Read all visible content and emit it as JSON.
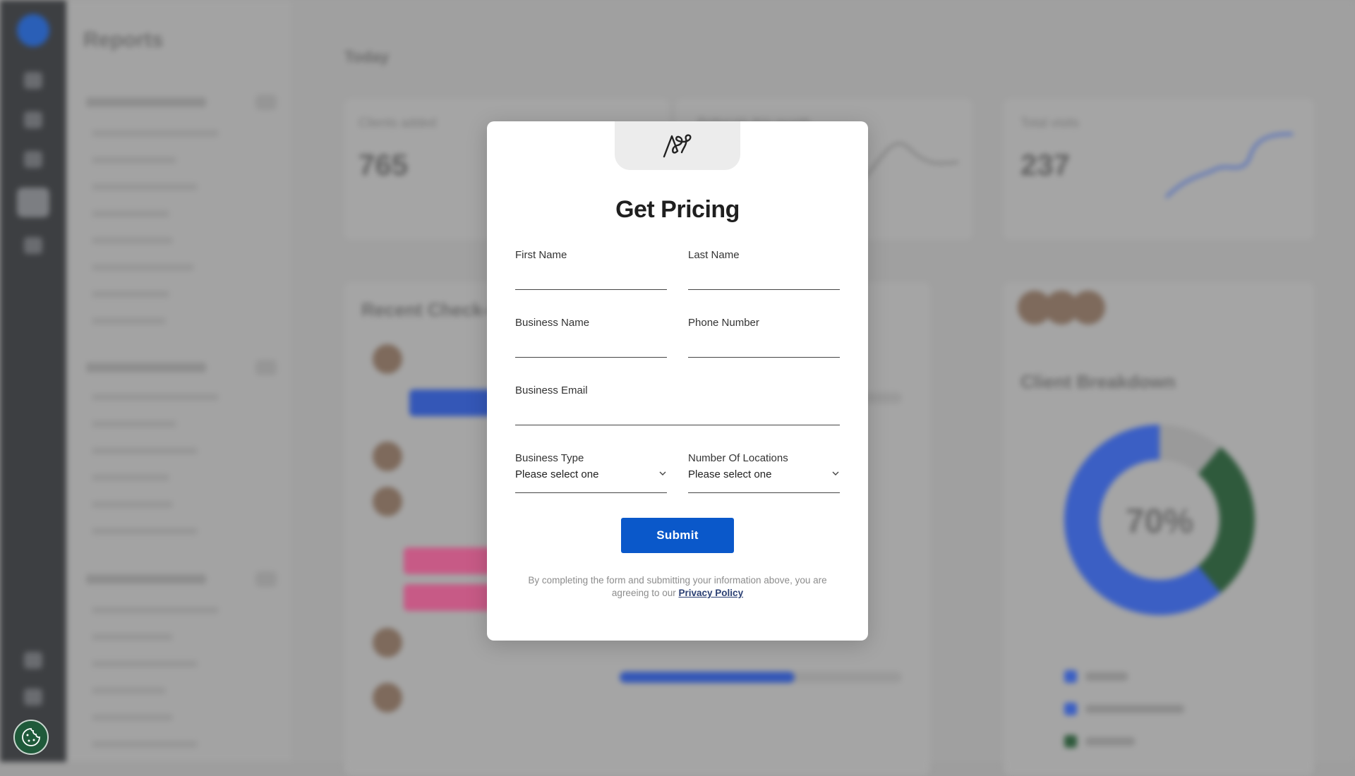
{
  "background": {
    "reports_title": "Reports",
    "breadcrumb": "Today",
    "stats": [
      {
        "label": "Clients added",
        "value": "765"
      },
      {
        "label": "Referrals this month",
        "value": ""
      },
      {
        "label": "Total visits",
        "value": "237"
      }
    ],
    "recent_checkins_title": "Recent Check-ins",
    "client_breakdown_title": "Client Breakdown",
    "donut_percent": "70%",
    "donut_values": [
      0.11,
      0.28,
      0.61
    ],
    "colors": {
      "rail": "#3d3f42",
      "accent_blue": "#3b5fc4",
      "accent_green": "#2f5a3c",
      "pink": "#c75a86"
    }
  },
  "cookie": {
    "icon": "cookie-icon"
  },
  "modal": {
    "logo_icon": "brand-logo-icon",
    "title": "Get Pricing",
    "fields": {
      "first_name": {
        "label": "First Name",
        "value": ""
      },
      "last_name": {
        "label": "Last Name",
        "value": ""
      },
      "business_name": {
        "label": "Business Name",
        "value": ""
      },
      "phone_number": {
        "label": "Phone Number",
        "value": ""
      },
      "business_email": {
        "label": "Business Email",
        "value": ""
      },
      "business_type": {
        "label": "Business Type",
        "value": "Please select one"
      },
      "number_of_locations": {
        "label": "Number Of Locations",
        "value": "Please select one"
      }
    },
    "submit_label": "Submit",
    "disclaimer_text": "By completing the form and submitting your information above, you are agreeing to our",
    "privacy_link": "Privacy Policy",
    "colors": {
      "submit": "#0a58ca",
      "link": "#2a3f73"
    }
  }
}
